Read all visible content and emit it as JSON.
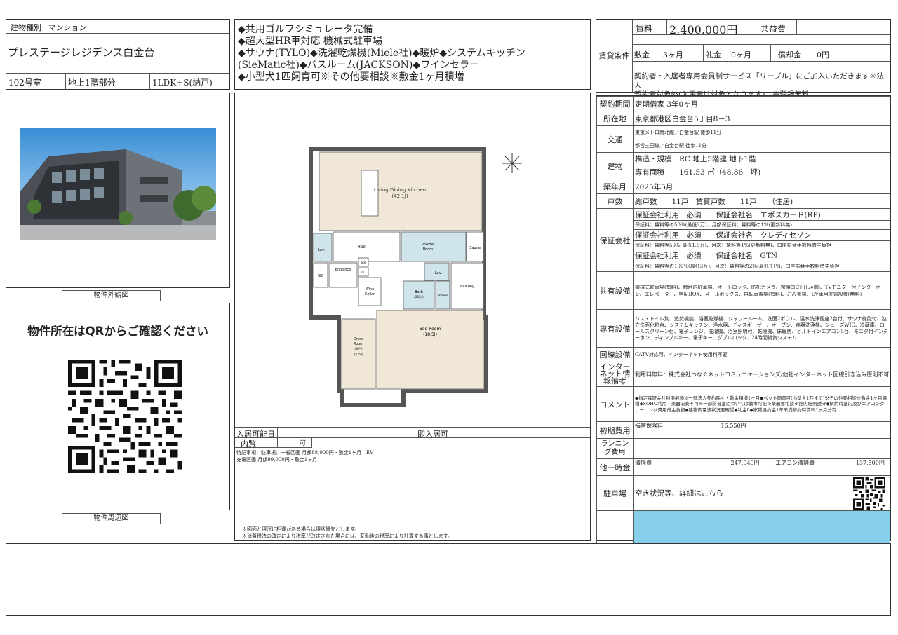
{
  "left": {
    "type_label": "建物種別",
    "type_value": "マンション",
    "building_name": "プレステージレジデンス白金台",
    "room": "102号室",
    "floor": "地上1階部分",
    "layout": "1LDK+S(納戸)",
    "exterior_caption": "物件外観図",
    "qr_heading": "物件所在はQRからご確認ください",
    "map_caption": "物件周辺図"
  },
  "features": [
    "◆共用ゴルフシミュレータ完備",
    "◆超大型HR車対応 機械式駐車場",
    "◆サウナ(TYLO)◆洗濯乾燥機(Miele社)◆暖炉◆システムキッチン",
    "(SieMatic社)◆バスルーム(JACKSON)◆ワインセラー",
    "◆小型犬1匹飼育可※その他要相談※敷金1ヶ月積増"
  ],
  "floorplan": {
    "ldk": "Living Dining Kitchen",
    "ldk_size": "(42.1J)",
    "hall": "Hall",
    "lav1": "Lav.",
    "sic": "SIC",
    "entrance": "Entrance",
    "ste": "Ste",
    "cl": "Cl.",
    "wine": "Wine",
    "cellar": "Cellar",
    "powder": "Powder",
    "room": "Room",
    "sauna": "Sauna",
    "lav2": "Lav.",
    "bath": "Bath",
    "bath_size": "(2024)",
    "shower": "Shower",
    "balcony": "Balcony",
    "dress": "Dress",
    "dress_room": "Room",
    "dress_note": "(納戸)",
    "dress_size": "(5.5J)",
    "bed": "Bed Room",
    "bed_size": "(18.5J)"
  },
  "move_in_label": "入居可能日",
  "move_in_value": "即入居可",
  "viewing_label": "内覧",
  "viewing_value": "可",
  "special_notes": "特記事項：駐車場：一般区画 月額88,000円・敷金1ヶ月　EV",
  "special_notes2": "充電区画 月額99,000円・敷金1ヶ月",
  "footer_note1": "※図面と現況に相違がある場合は現状優先とします。",
  "footer_note2": "※消費税法の改定により税率が改定された場合には、変動後の税率により計算する事とします。",
  "rent": {
    "section_label": "賃貸条件",
    "rent_label": "賃料",
    "rent_value": "2,400,000円",
    "common_label": "共益費",
    "common_value": "",
    "deposit_label": "敷金",
    "deposit_value": "3ヶ月",
    "key_label": "礼金",
    "key_value": "0ヶ月",
    "amort_label": "償却金",
    "amort_value": "0円",
    "note1": "契約者・入居者専用会員制サービス「リーブル」にご加入いただきます※法人",
    "note2": "契約者対象外(入居者は対象となります)　※登録無料"
  },
  "spec": {
    "contract_label": "契約期間",
    "contract": "定期借家 3年0ヶ月",
    "address_label": "所在地",
    "address": "東京都港区白金台5丁目8－3",
    "transport_label": "交通",
    "transport1": "東京メトロ南北線／白金台駅 徒歩11分",
    "transport2": "都営三田線／白金台駅 徒歩11分",
    "building_label": "建物",
    "structure": "構造・規模　RC 地上5階建 地下1階",
    "area": "専有面積　　161.53 ㎡（48.86　坪)",
    "built_label": "築年月",
    "built": "2025年5月",
    "units_label": "戸数",
    "units": "総戸数　　11戸　賃貸戸数　　11戸　　（住居)",
    "guarantee_label": "保証会社",
    "g1": "保証会社利用　必須　　保証会社名　エポスカード(RP)",
    "g1n": "保証料：賃料等の50%(最低2万)、月額保証料：賃料等の1%(更新料無)",
    "g2": "保証会社利用　必須　　保証会社名　クレディセゾン",
    "g2n": "保証料：賃料等50%(最低1.5万)、月次：賃料等1%(更新料無)、口座振替手数料借主負担",
    "g3": "保証会社利用　必須　　保証会社名　GTN",
    "g3n": "保証料：賃料等の100%(最低3万)、月次：賃料等の2%(最低千円)、口座振替手数料借主負担",
    "common_fac_label": "共有設備",
    "common_fac": "機械式駐車場(有料)、敷地内駐車場、オートロック、防犯カメラ、常時ゴミ出し可能、TVモニター付インターホン、エレベーター、宅配BOX、メールボックス、自転車置場(有料)、ごみ置場、EV車用充電設備(無料)",
    "private_fac_label": "専有設備",
    "private_fac": "バス・トイレ別、追焚機能、浴室乾燥機、シャワールーム、洗面2ボウル、温水洗浄便座2台付、サウナ機能付、独立洗面化粧台、システムキッチン、浄水器、ディスポーザー、オーブン、食器洗浄機、シューズWIC、冷蔵庫、ロールスクリーン付、電子レンジ、洗濯機、浴室照明付、乾燥機、床暖房、ビルトインエアコン5台、モニタ付インターホン、ディンプルキー、電子キー、ダブルロック、24時間換気システム",
    "line_label": "回線設備",
    "line": "CATV対応可、インターネット使用料不要",
    "internet_label": "インターネット情報備考",
    "internet": "利用料無料：株式会社つなぐネットコミュニケーションズ/他社インターネット回線引き込み原則不可",
    "comment_label": "コメント",
    "comment": "◆指定保証会社利用必須※一部法人契約除く・敷金積増1ヶ月◆ペット飼育可(小型犬1匹まで)※その他要相談※敷金1ヶ月積増◆SOHO利用・楽器演奏不可※一部防音室については備考可能※楽器要相談※館内細則遵守◆解約時室内及びエアコンクリーニング費用借主負担◆建物内電波状況要確認◆礼金0◆家賃違約金1年未満解約時賃料1ヶ月分有",
    "initial_label": "初期費用",
    "initial_item": "損害保険料",
    "initial_value": "16,550円",
    "running_label": "ランニング費用",
    "other_label": "他一時金",
    "other1_item": "清掃費",
    "other1_value": "247,940円",
    "other2_item": "エアコン清掃費",
    "other2_value": "137,500円",
    "parking_label": "駐車場",
    "parking": "空き状況等、詳細はこちら"
  },
  "colors": {
    "accent_blue": "#87ceea",
    "border": "#333333"
  }
}
